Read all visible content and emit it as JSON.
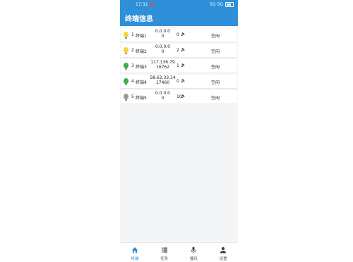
{
  "status_bar": {
    "time": "17:32",
    "right_text": "5G 5G"
  },
  "app_bar": {
    "title": "终端信息"
  },
  "terminals": [
    {
      "index": "1",
      "name": "终端1",
      "ip": "0.0.0.0",
      "port": "0",
      "count": "0",
      "status": "空闲",
      "color": "#f5d33b"
    },
    {
      "index": "2",
      "name": "终端2",
      "ip": "0.0.0.0",
      "port": "0",
      "count": "2",
      "status": "空闲",
      "color": "#f5d33b"
    },
    {
      "index": "3",
      "name": "终端3",
      "ip": "117.136.79",
      "port": "16762",
      "count": "1",
      "status": "空闲",
      "color": "#3fad4a"
    },
    {
      "index": "4",
      "name": "终端4",
      "ip": "58.62.33.14",
      "port": "17460",
      "count": "0",
      "status": "空闲",
      "color": "#3fad4a"
    },
    {
      "index": "5",
      "name": "终端5",
      "ip": "0.0.0.0",
      "port": "0",
      "count": "10",
      "status": "空闲",
      "color": "#9a9a9a"
    }
  ],
  "tabs": [
    {
      "label": "终端",
      "icon": "home-icon",
      "active": true
    },
    {
      "label": "任务",
      "icon": "list-icon",
      "active": false
    },
    {
      "label": "播讯",
      "icon": "mic-icon",
      "active": false
    },
    {
      "label": "设置",
      "icon": "person-icon",
      "active": false
    }
  ],
  "colors": {
    "accent": "#2f8fd8",
    "speaker": "#2ea843"
  }
}
